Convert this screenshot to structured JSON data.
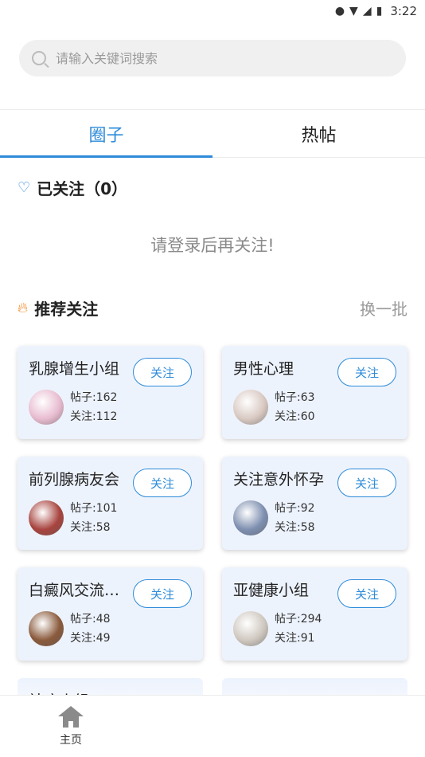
{
  "status_bar": {
    "time": "3:22"
  },
  "search": {
    "placeholder": "请输入关键词搜索"
  },
  "tabs": [
    {
      "label": "圈子",
      "active": true
    },
    {
      "label": "热帖",
      "active": false
    }
  ],
  "followed": {
    "title": "已关注（0）",
    "login_hint": "请登录后再关注!"
  },
  "recommend": {
    "title": "推荐关注",
    "refresh_label": "换一批",
    "follow_label": "关注",
    "groups": [
      {
        "name": "乳腺增生小组",
        "posts": "帖子:162",
        "followers": "关注:112",
        "avatar_color": "#e8bcd0"
      },
      {
        "name": "男性心理",
        "posts": "帖子:63",
        "followers": "关注:60",
        "avatar_color": "#d9c9c2"
      },
      {
        "name": "前列腺病友会",
        "posts": "帖子:101",
        "followers": "关注:58",
        "avatar_color": "#a8443f"
      },
      {
        "name": "关注意外怀孕",
        "posts": "帖子:92",
        "followers": "关注:58",
        "avatar_color": "#7e8fb0"
      },
      {
        "name": "白癜风交流…",
        "posts": "帖子:48",
        "followers": "关注:49",
        "avatar_color": "#8a5a3c"
      },
      {
        "name": "亚健康小组",
        "posts": "帖子:294",
        "followers": "关注:91",
        "avatar_color": "#cfc8c0"
      },
      {
        "name": "祛痘小组"
      }
    ]
  },
  "bottom_nav": {
    "home_label": "主页"
  },
  "colors": {
    "accent": "#2e8bd9",
    "card_bg": "#edf3fd",
    "fire": "#f08a24"
  }
}
